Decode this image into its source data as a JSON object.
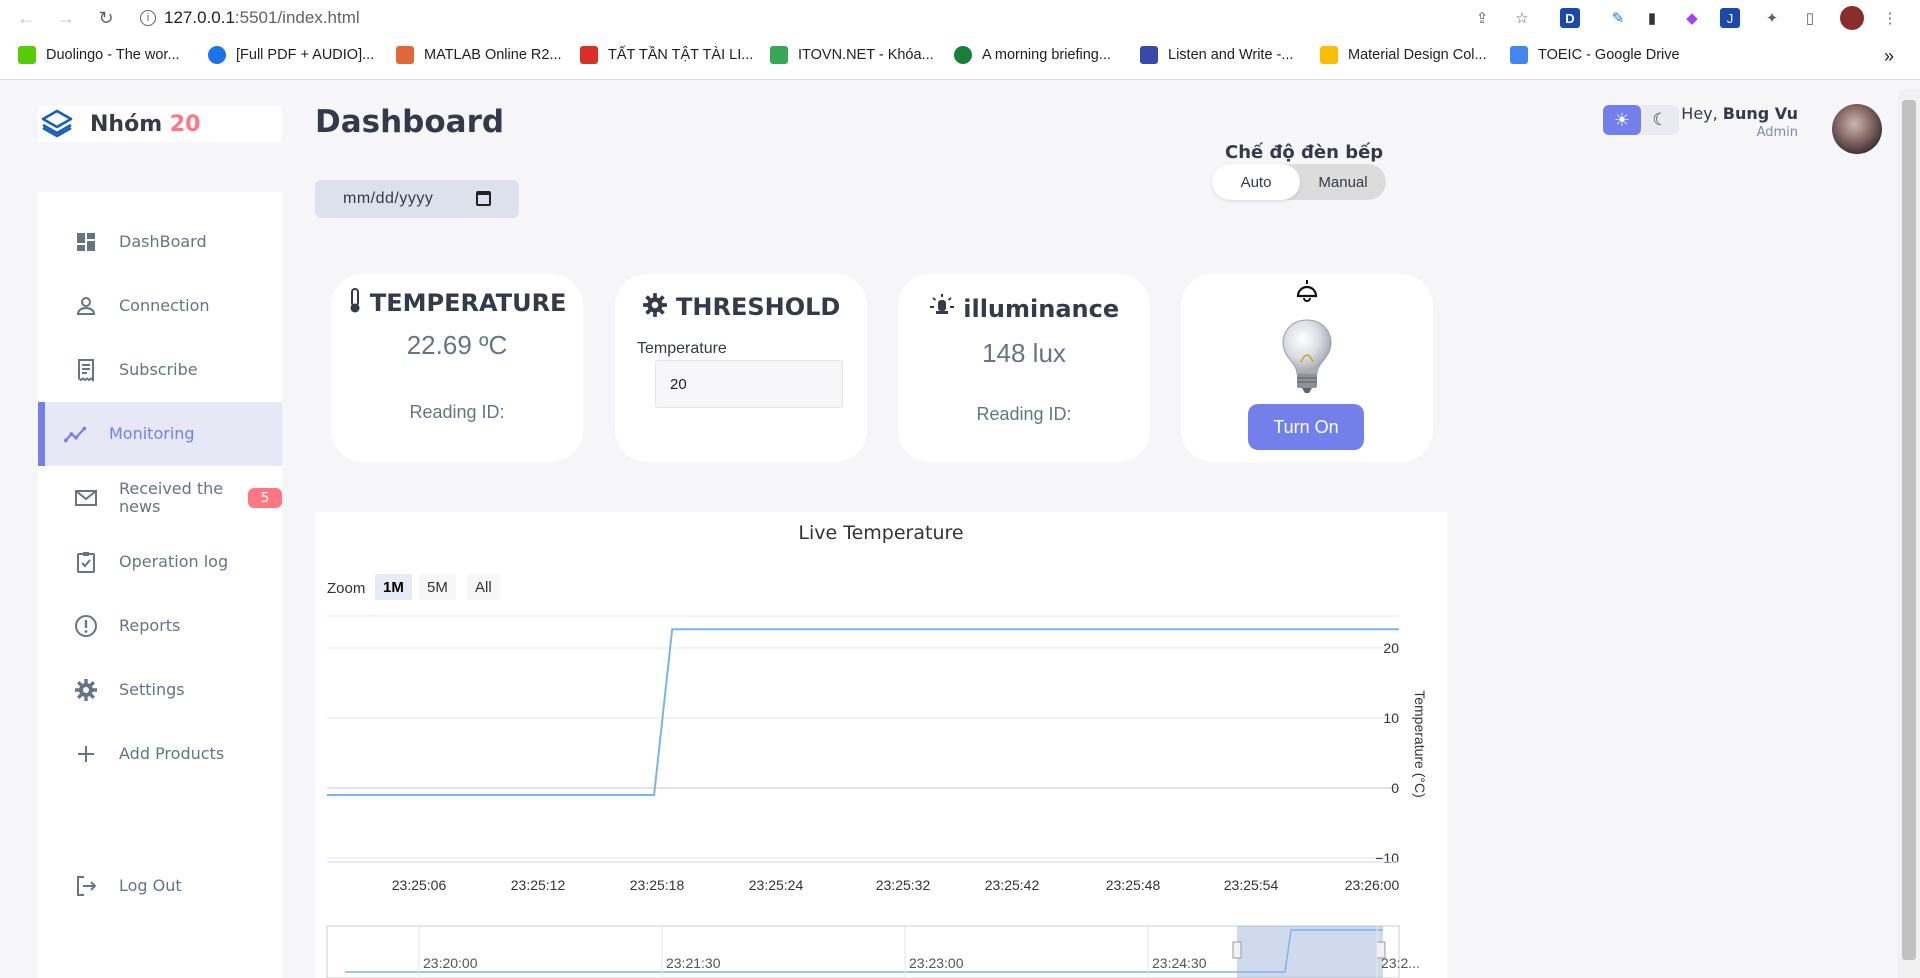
{
  "browser": {
    "url_host": "127.0.0.1",
    "url_path": ":5501/index.html",
    "bookmarks": [
      {
        "label": "Duolingo - The wor...",
        "color": "#58cc02"
      },
      {
        "label": "[Full PDF + AUDIO]...",
        "color": "#1a73e8"
      },
      {
        "label": "MATLAB Online R2...",
        "color": "#e16737"
      },
      {
        "label": "TẤT TẦN TẬT TÀI LI...",
        "color": "#d93025"
      },
      {
        "label": "ITOVN.NET - Khóa...",
        "color": "#34a853"
      },
      {
        "label": "A morning briefing...",
        "color": "#188038"
      },
      {
        "label": "Listen and Write -...",
        "color": "#3949ab"
      },
      {
        "label": "Material Design Col...",
        "color": "#fbbc04"
      },
      {
        "label": "TOEIC - Google Drive",
        "color": "#4285f4"
      }
    ],
    "more_bookmarks": "»"
  },
  "brand": {
    "name": "Nhóm ",
    "number": "20"
  },
  "sidebar": {
    "items": [
      {
        "label": "DashBoard",
        "icon": "dashboard-icon"
      },
      {
        "label": "Connection",
        "icon": "person-icon"
      },
      {
        "label": "Subscribe",
        "icon": "receipt-icon"
      },
      {
        "label": "Monitoring",
        "icon": "insights-icon",
        "active": true
      },
      {
        "label": "Received the news",
        "icon": "mail-icon",
        "badge": "5"
      },
      {
        "label": "Operation log",
        "icon": "clipboard-icon"
      },
      {
        "label": "Reports",
        "icon": "report-icon"
      },
      {
        "label": "Settings",
        "icon": "gear-icon"
      },
      {
        "label": "Add Products",
        "icon": "add-icon"
      }
    ],
    "logout": "Log Out"
  },
  "header": {
    "title": "Dashboard",
    "date_placeholder": "mm/dd/yyyy",
    "mode_label": "Chế độ đèn bếp",
    "mode_auto": "Auto",
    "mode_manual": "Manual",
    "greeting": "Hey, ",
    "user_name": "Bung Vu",
    "user_role": "Admin"
  },
  "cards": {
    "temperature": {
      "title": "TEMPERATURE",
      "value": "22.69 ºC",
      "reading": "Reading ID:"
    },
    "threshold": {
      "title": "THRESHOLD",
      "label": "Temperature",
      "value": "20"
    },
    "illuminance": {
      "title": "illuminance",
      "value": "148 lux",
      "reading": "Reading ID:"
    },
    "lamp": {
      "button": "Turn On"
    }
  },
  "chart_data": {
    "type": "line",
    "title": "Live Temperature",
    "ylabel": "Temperature (°C)",
    "ylim": [
      -10,
      20
    ],
    "yticks": [
      "20",
      "10",
      "0",
      "-10"
    ],
    "xticks": [
      "23:25:06",
      "23:25:12",
      "23:25:18",
      "23:25:24",
      "23:25:32",
      "23:25:42",
      "23:25:48",
      "23:25:54",
      "23:26:00"
    ],
    "zoom_label": "Zoom",
    "zoom_options": [
      "1M",
      "5M",
      "All"
    ],
    "zoom_selected": "1M",
    "series": [
      {
        "values": [
          {
            "t": "23:25:01",
            "y": -1
          },
          {
            "t": "23:25:19",
            "y": -1
          },
          {
            "t": "23:25:20",
            "y": 22.69
          },
          {
            "t": "23:26:00",
            "y": 22.69
          }
        ],
        "color": "#7cb5ec"
      }
    ],
    "navigator_ticks": [
      "23:20:00",
      "23:21:30",
      "23:23:00",
      "23:24:30",
      "23:2..."
    ]
  }
}
